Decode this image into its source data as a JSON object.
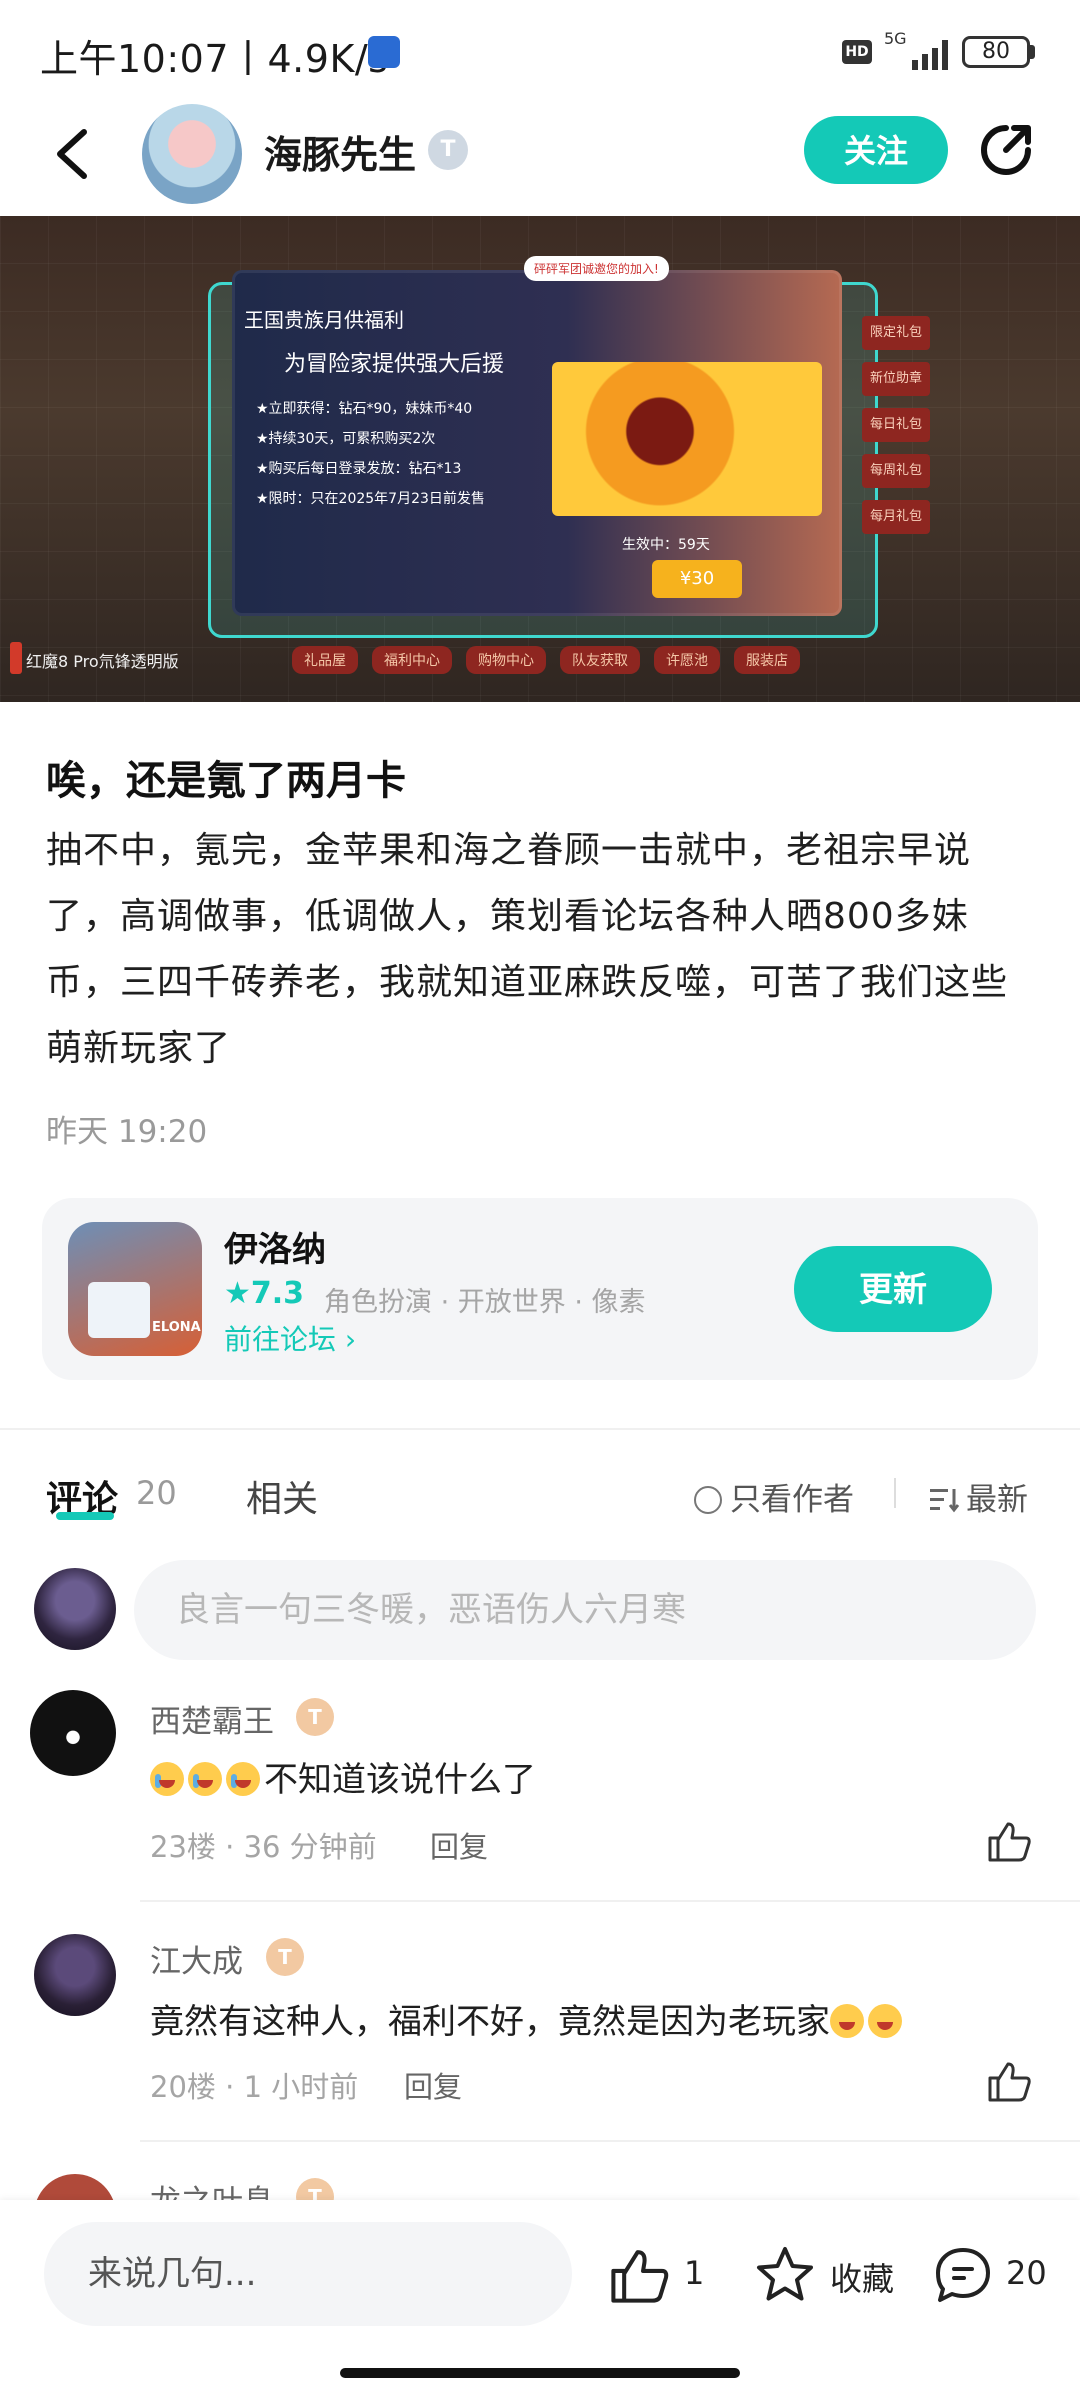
{
  "status_bar": {
    "time_speed": "上午10:07丨4.9K/s",
    "hd": "HD",
    "network": "5G",
    "battery": "80"
  },
  "header": {
    "author_name": "海豚先生",
    "level_badge": "T",
    "follow_label": "关注"
  },
  "hero": {
    "bubble": "砰砰军团诚邀您的加入!",
    "card_title": "王国贵族月供福利",
    "card_subtitle": "为冒险家提供强大后援",
    "perks": [
      "★立即获得：钻石*90，妹妹币*40",
      "★持续30天，可累积购买2次",
      "★购买后每日登录发放：钻石*13",
      "★限时：只在2025年7月23日前发售"
    ],
    "active_label": "生效中：59天",
    "price": "¥30",
    "tags": [
      "礼品屋",
      "福利中心",
      "购物中心",
      "队友获取",
      "许愿池",
      "服装店"
    ],
    "side_items": [
      "限定礼包",
      "新位助章",
      "每日礼包",
      "每周礼包",
      "每月礼包"
    ],
    "watermark": "红魔8 Pro氘锋透明版"
  },
  "post": {
    "title": "唉，还是氪了两月卡",
    "body": "抽不中，氪完，金苹果和海之眷顾一击就中，老祖宗早说了，高调做事，低调做人，策划看论坛各种人晒800多妹币，三四千砖养老，我就知道亚麻跌反噬，可苦了我们这些萌新玩家了",
    "time": "昨天 19:20"
  },
  "game": {
    "name": "伊洛纳",
    "icon_label": "ELONA",
    "score": "★7.3",
    "tags": "角色扮演 · 开放世界 · 像素",
    "forum_link": "前往论坛 ›",
    "update_label": "更新"
  },
  "tabs": {
    "comment_label": "评论",
    "comment_count": "20",
    "related_label": "相关",
    "only_author": "只看作者",
    "newest": "最新"
  },
  "comment_input": {
    "placeholder": "良言一句三冬暖，恶语伤人六月寒"
  },
  "comments": [
    {
      "name": "西楚霸王",
      "badge": "T",
      "text": "不知道该说什么了",
      "floor": "23楼",
      "time": "36 分钟前",
      "reply": "回复"
    },
    {
      "name": "江大成",
      "badge": "T",
      "text": "竟然有这种人，福利不好，竟然是因为老玩家",
      "floor": "20楼",
      "time": "1 小时前",
      "reply": "回复"
    },
    {
      "name": "龙之叶息",
      "badge": "T"
    }
  ],
  "bottom_bar": {
    "say_placeholder": "来说几句...",
    "like_count": "1",
    "fav_label": "收藏",
    "comment_count": "20"
  },
  "colors": {
    "accent": "#14c9b7",
    "text_primary": "#1f1f1f",
    "text_secondary": "#9a9a9a",
    "card_bg": "#f4f5f7"
  }
}
